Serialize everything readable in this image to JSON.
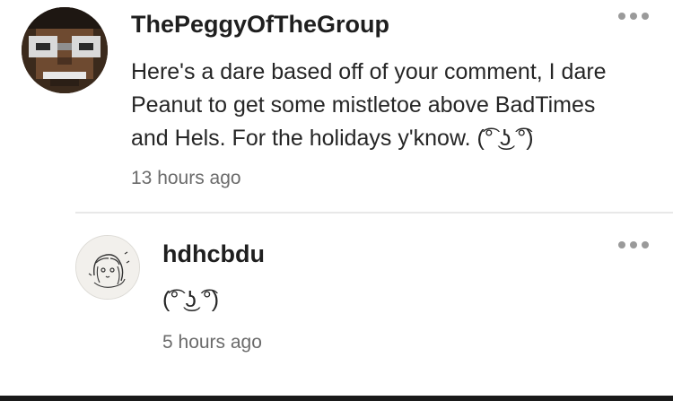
{
  "comments": [
    {
      "username": "ThePeggyOfTheGroup",
      "body": "Here's a dare based off of your comment, I dare Peanut to get some mistletoe above BadTimes and Hels. For the holidays y'know. (͡° ͜ʖ ͡°)",
      "timestamp": "13 hours ago",
      "avatar_icon": "minecraft-skin-face-avatar",
      "more_icon": "more-options-icon"
    },
    {
      "username": "hdhcbdu",
      "body": "(͡° ͜ʖ ͡°)",
      "timestamp": "5 hours ago",
      "avatar_icon": "sketch-drawing-avatar",
      "more_icon": "more-options-icon"
    }
  ],
  "colors": {
    "username": "#1f1f1f",
    "body": "#262626",
    "timestamp": "#6b6b6b",
    "dots": "#9a9a9a",
    "separator": "#e8e8e8"
  }
}
